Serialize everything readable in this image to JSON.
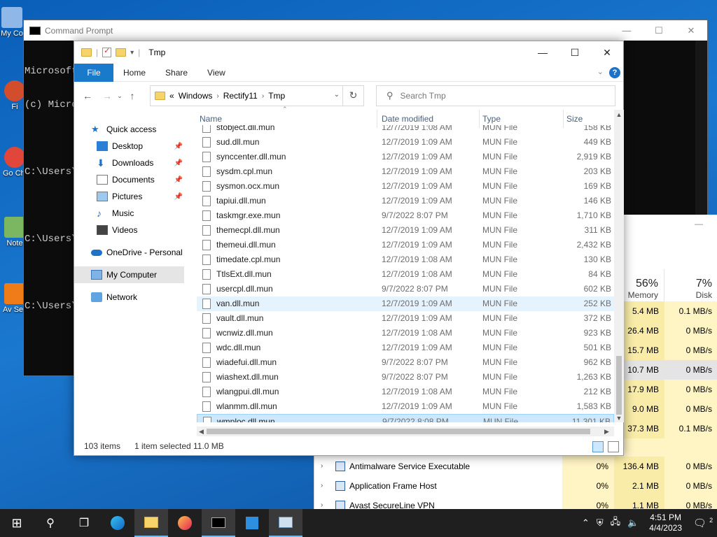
{
  "desktop": {
    "icons": [
      {
        "label": "My Co",
        "color": "#8fb8e8"
      },
      {
        "label": "Fi",
        "color": "#d24d2b"
      },
      {
        "label": "Go Chr",
        "color": "#e0463a"
      },
      {
        "label": "Note",
        "color": "#7bb661"
      },
      {
        "label": "Av Secu",
        "color": "#f07c19"
      }
    ]
  },
  "cmd": {
    "title": "Command Prompt",
    "lines": [
      "Microsoft",
      "(c) Micro",
      "",
      "C:\\Users\\",
      "",
      "C:\\Users\\",
      "",
      "C:\\Users\\"
    ]
  },
  "explorer": {
    "title": "Tmp",
    "tabs": {
      "file": "File",
      "home": "Home",
      "share": "Share",
      "view": "View"
    },
    "help": "?",
    "address": {
      "lead": "«",
      "crumbs": [
        "Windows",
        "Rectify11",
        "Tmp"
      ]
    },
    "search_placeholder": "Search Tmp",
    "nav": {
      "quick_access": "Quick access",
      "desktop": "Desktop",
      "downloads": "Downloads",
      "documents": "Documents",
      "pictures": "Pictures",
      "music": "Music",
      "videos": "Videos",
      "onedrive": "OneDrive - Personal",
      "my_computer": "My Computer",
      "network": "Network"
    },
    "columns": {
      "name": "Name",
      "date": "Date modified",
      "type": "Type",
      "size": "Size"
    },
    "rows": [
      {
        "name": "stobject.dll.mun",
        "date": "12/7/2019 1:08 AM",
        "type": "MUN File",
        "size": "158 KB"
      },
      {
        "name": "sud.dll.mun",
        "date": "12/7/2019 1:09 AM",
        "type": "MUN File",
        "size": "449 KB"
      },
      {
        "name": "synccenter.dll.mun",
        "date": "12/7/2019 1:09 AM",
        "type": "MUN File",
        "size": "2,919 KB"
      },
      {
        "name": "sysdm.cpl.mun",
        "date": "12/7/2019 1:09 AM",
        "type": "MUN File",
        "size": "203 KB"
      },
      {
        "name": "sysmon.ocx.mun",
        "date": "12/7/2019 1:09 AM",
        "type": "MUN File",
        "size": "169 KB"
      },
      {
        "name": "tapiui.dll.mun",
        "date": "12/7/2019 1:09 AM",
        "type": "MUN File",
        "size": "146 KB"
      },
      {
        "name": "taskmgr.exe.mun",
        "date": "9/7/2022 8:07 PM",
        "type": "MUN File",
        "size": "1,710 KB"
      },
      {
        "name": "themecpl.dll.mun",
        "date": "12/7/2019 1:09 AM",
        "type": "MUN File",
        "size": "311 KB"
      },
      {
        "name": "themeui.dll.mun",
        "date": "12/7/2019 1:09 AM",
        "type": "MUN File",
        "size": "2,432 KB"
      },
      {
        "name": "timedate.cpl.mun",
        "date": "12/7/2019 1:08 AM",
        "type": "MUN File",
        "size": "130 KB"
      },
      {
        "name": "TtlsExt.dll.mun",
        "date": "12/7/2019 1:08 AM",
        "type": "MUN File",
        "size": "84 KB"
      },
      {
        "name": "usercpl.dll.mun",
        "date": "9/7/2022 8:07 PM",
        "type": "MUN File",
        "size": "602 KB"
      },
      {
        "name": "van.dll.mun",
        "date": "12/7/2019 1:09 AM",
        "type": "MUN File",
        "size": "252 KB"
      },
      {
        "name": "vault.dll.mun",
        "date": "12/7/2019 1:09 AM",
        "type": "MUN File",
        "size": "372 KB"
      },
      {
        "name": "wcnwiz.dll.mun",
        "date": "12/7/2019 1:08 AM",
        "type": "MUN File",
        "size": "923 KB"
      },
      {
        "name": "wdc.dll.mun",
        "date": "12/7/2019 1:09 AM",
        "type": "MUN File",
        "size": "501 KB"
      },
      {
        "name": "wiadefui.dll.mun",
        "date": "9/7/2022 8:07 PM",
        "type": "MUN File",
        "size": "962 KB"
      },
      {
        "name": "wiashext.dll.mun",
        "date": "9/7/2022 8:07 PM",
        "type": "MUN File",
        "size": "1,263 KB"
      },
      {
        "name": "wlangpui.dll.mun",
        "date": "12/7/2019 1:08 AM",
        "type": "MUN File",
        "size": "212 KB"
      },
      {
        "name": "wlanmm.dll.mun",
        "date": "12/7/2019 1:09 AM",
        "type": "MUN File",
        "size": "1,583 KB"
      },
      {
        "name": "wmploc.dll.mun",
        "date": "9/7/2022 8:08 PM",
        "type": "MUN File",
        "size": "11,301 KB"
      }
    ],
    "hovered_row": 12,
    "selected_row": 20,
    "status": {
      "items": "103 items",
      "selected": "1 item selected",
      "size": "11.0 MB"
    }
  },
  "taskmgr": {
    "memory_pct": "56%",
    "memory_label": "Memory",
    "disk_pct": "7%",
    "disk_label": "Disk",
    "rows": [
      {
        "mem": "5.4 MB",
        "disk": "0.1 MB/s"
      },
      {
        "mem": "26.4 MB",
        "disk": "0 MB/s"
      },
      {
        "mem": "15.7 MB",
        "disk": "0 MB/s"
      },
      {
        "mem": "10.7 MB",
        "disk": "0 MB/s"
      },
      {
        "mem": "17.9 MB",
        "disk": "0 MB/s"
      },
      {
        "mem": "9.0 MB",
        "disk": "0 MB/s"
      },
      {
        "mem": "37.3 MB",
        "disk": "0.1 MB/s"
      }
    ],
    "procs": [
      {
        "name": "Antimalware Service Executable",
        "cpu": "0%",
        "mem": "136.4 MB",
        "disk": "0 MB/s"
      },
      {
        "name": "Application Frame Host",
        "cpu": "0%",
        "mem": "2.1 MB",
        "disk": "0 MB/s"
      },
      {
        "name": "Avast SecureLine VPN",
        "cpu": "0%",
        "mem": "1.1 MB",
        "disk": "0 MB/s"
      }
    ],
    "colors": {
      "light": "#fff4c4",
      "mid": "#f9eca8",
      "sel": "#e4e4e4"
    }
  },
  "taskbar": {
    "time": "4:51 PM",
    "date": "4/4/2023",
    "notif_count": "2"
  }
}
